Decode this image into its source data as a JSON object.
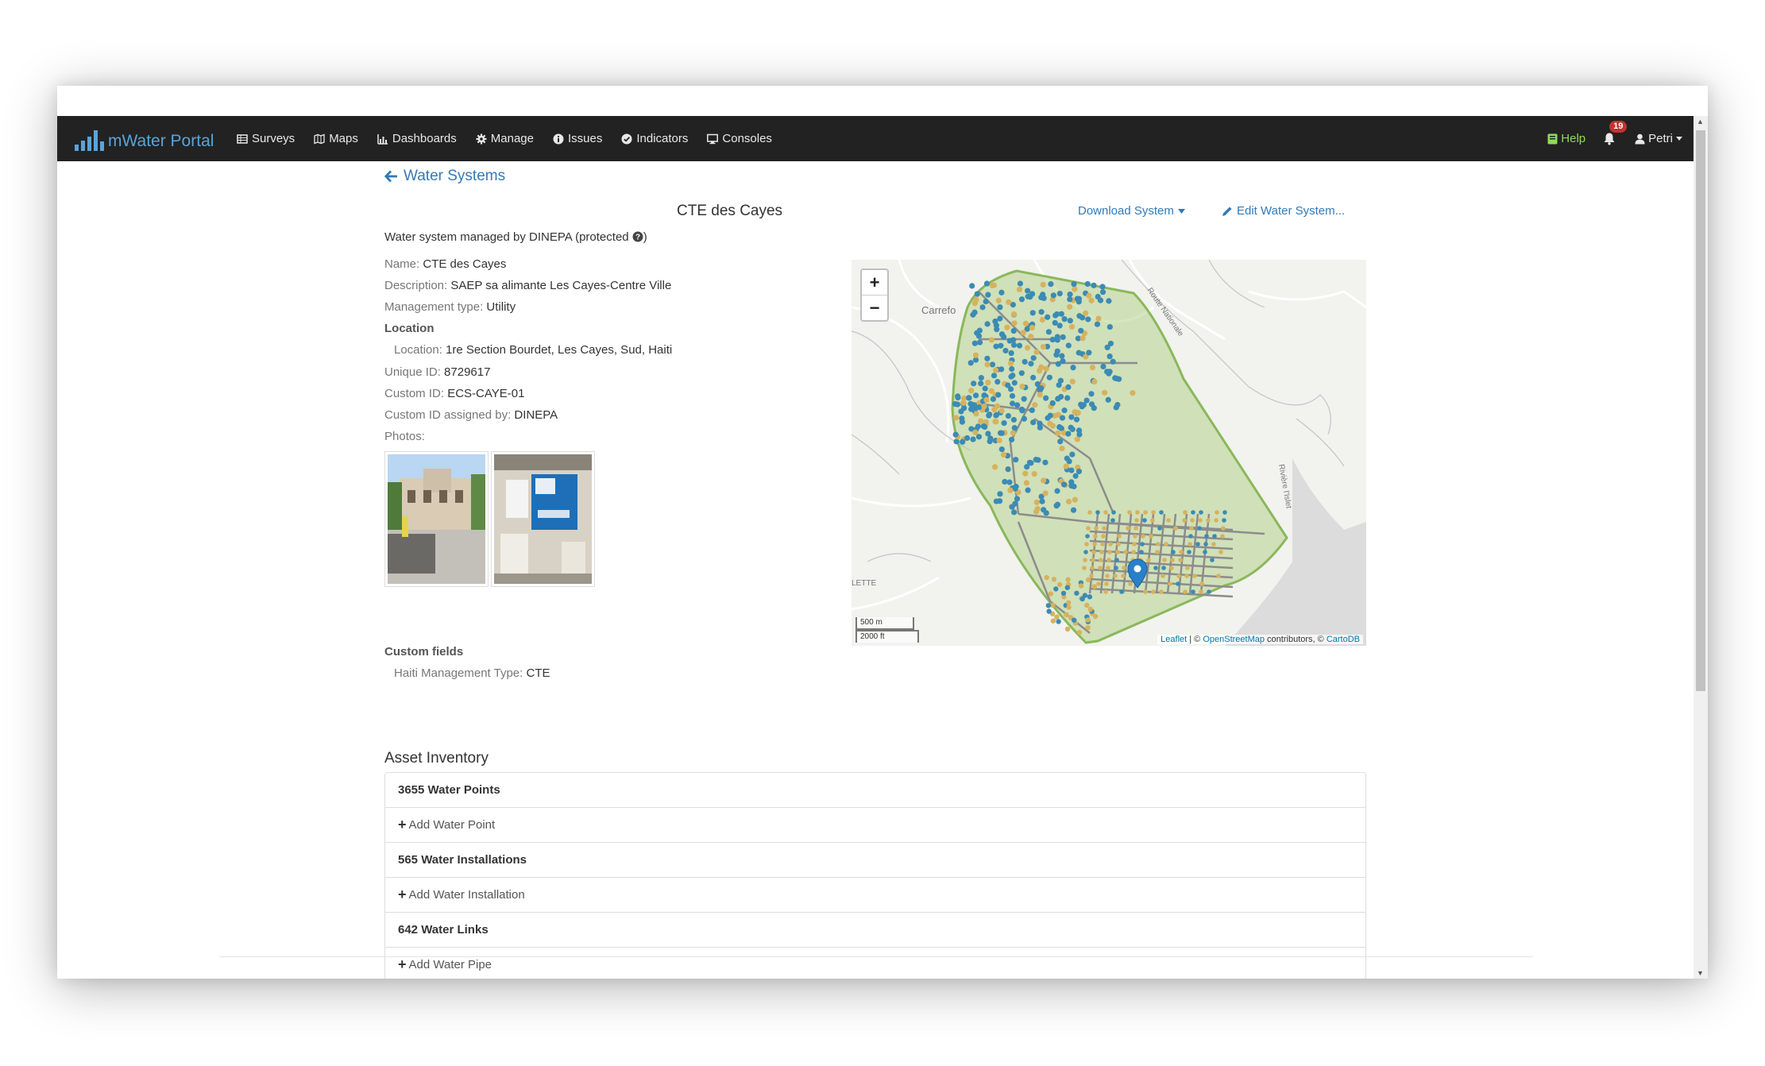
{
  "app": {
    "brand": "mWater Portal"
  },
  "nav": {
    "items": [
      {
        "label": "Surveys",
        "icon": "table-icon"
      },
      {
        "label": "Maps",
        "icon": "map-icon"
      },
      {
        "label": "Dashboards",
        "icon": "bar-chart-icon"
      },
      {
        "label": "Manage",
        "icon": "gear-icon"
      },
      {
        "label": "Issues",
        "icon": "info-circle-icon"
      },
      {
        "label": "Indicators",
        "icon": "check-circle-icon"
      },
      {
        "label": "Consoles",
        "icon": "monitor-icon"
      }
    ],
    "help": "Help",
    "notifications": "19",
    "user": "Petri"
  },
  "page": {
    "back_label": "Water Systems",
    "title": "CTE des Cayes",
    "download_label": "Download System",
    "edit_label": "Edit Water System...",
    "managed_text": "Water system managed by DINEPA (protected",
    "managed_close": ")"
  },
  "fields": {
    "name": {
      "label": "Name:",
      "value": "CTE des Cayes"
    },
    "description": {
      "label": "Description:",
      "value": "SAEP sa alimante Les Cayes-Centre Ville"
    },
    "management_type": {
      "label": "Management type:",
      "value": "Utility"
    },
    "location_heading": "Location",
    "location": {
      "label": "Location:",
      "value": "1re Section Bourdet, Les Cayes, Sud, Haiti"
    },
    "unique_id": {
      "label": "Unique ID:",
      "value": "8729617"
    },
    "custom_id": {
      "label": "Custom ID:",
      "value": "ECS-CAYE-01"
    },
    "custom_id_by": {
      "label": "Custom ID assigned by:",
      "value": "DINEPA"
    },
    "photos_label": "Photos:",
    "custom_fields_heading": "Custom fields",
    "haiti_mgmt": {
      "label": "Haiti Management Type:",
      "value": "CTE"
    }
  },
  "map": {
    "zoom_in": "+",
    "zoom_out": "−",
    "scale_metric": "500 m",
    "scale_imperial": "2000 ft",
    "attribution_leaflet": "Leaflet",
    "attribution_sep": " | © ",
    "attribution_osm": "OpenStreetMap",
    "attribution_mid": " contributors, © ",
    "attribution_carto": "CartoDB",
    "place_carrefour": "Carrefo",
    "place_route": "Route Nationale",
    "place_riviere": "Rivière l'Islet",
    "place_lette": "LETTE"
  },
  "inventory": {
    "title": "Asset Inventory",
    "rows": [
      {
        "label": "3655 Water Points"
      },
      {
        "label": "Add Water Point"
      },
      {
        "label": "565 Water Installations"
      },
      {
        "label": "Add Water Installation"
      },
      {
        "label": "642 Water Links"
      },
      {
        "label": "Add Water Pipe"
      }
    ]
  },
  "colors": {
    "navbar": "#222222",
    "link": "#337ab7",
    "brand": "#5ba3d9",
    "help": "#8fdb5a",
    "polygon": "#8ab85a",
    "point_blue": "#3b8bb4",
    "point_yellow": "#d6b25e"
  }
}
